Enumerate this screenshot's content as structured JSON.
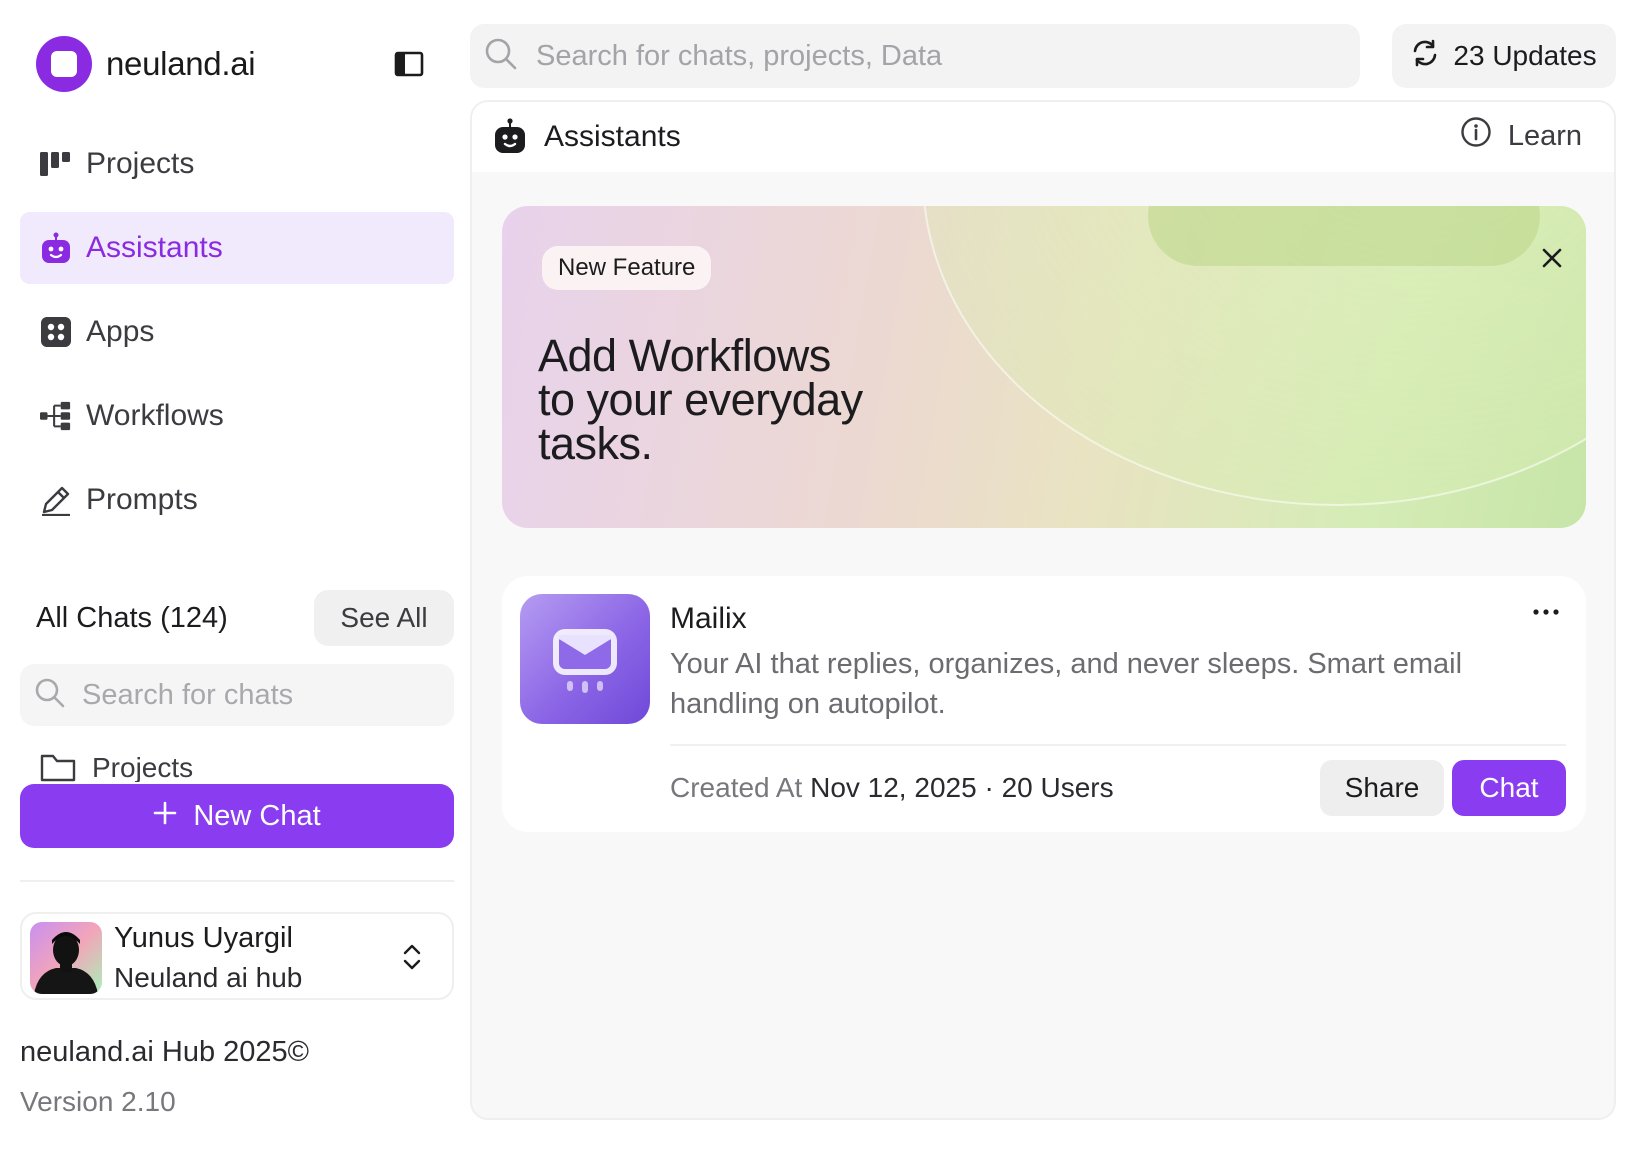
{
  "brand": {
    "name": "neuland.ai"
  },
  "sidebar": {
    "items": [
      {
        "label": "Projects",
        "icon": "kanban-icon",
        "active": false
      },
      {
        "label": "Assistants",
        "icon": "robot-icon",
        "active": true
      },
      {
        "label": "Apps",
        "icon": "apps-grid-icon",
        "active": false
      },
      {
        "label": "Workflows",
        "icon": "workflow-icon",
        "active": false
      },
      {
        "label": "Prompts",
        "icon": "pencil-icon",
        "active": false
      }
    ],
    "chats": {
      "title": "All Chats (124)",
      "see_all_label": "See All",
      "search_placeholder": "Search for chats",
      "projects_folder_label": "Projects"
    },
    "new_chat_label": "New Chat",
    "user": {
      "name": "Yunus Uyargil",
      "org": "Neuland ai hub"
    },
    "footer": {
      "copyright": "neuland.ai Hub 2025©",
      "version": "Version 2.10"
    }
  },
  "topbar": {
    "search_placeholder": "Search for chats, projects, Data",
    "updates_label": "23 Updates"
  },
  "main": {
    "title": "Assistants",
    "learn_label": "Learn",
    "banner": {
      "badge": "New Feature",
      "title": "Add Workflows to your everyday tasks."
    },
    "assistant_card": {
      "name": "Mailix",
      "description": "Your AI that replies, organizes, and never sleeps. Smart email handling on autopilot.",
      "created_label": "Created At",
      "created_date": "Nov 12, 2025",
      "separator": "·",
      "users": "20 Users",
      "share_label": "Share",
      "chat_label": "Chat"
    }
  },
  "colors": {
    "accent": "#8a3cf0",
    "active_bg": "#f1eafc",
    "panel_bg": "#f8f8f8"
  }
}
